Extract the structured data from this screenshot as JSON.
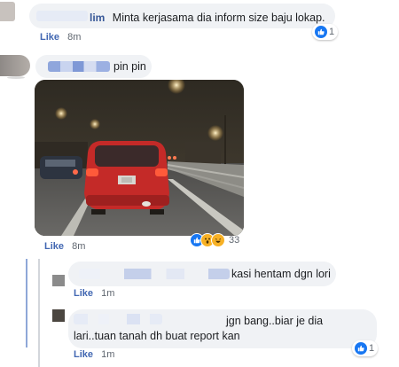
{
  "comments": [
    {
      "id": "c1",
      "author_visible": "lim",
      "text": "Minta kerjasama dia inform size baju lokap.",
      "like_label": "Like",
      "time": "8m",
      "reaction_count": "1"
    },
    {
      "id": "c2",
      "text": "pin pin",
      "like_label": "Like",
      "time": "8m",
      "reaction_count": "33",
      "photo_plate": "WXY 8"
    }
  ],
  "replies": [
    {
      "id": "r1",
      "text": "kasi hentam dgn lori",
      "like_label": "Like",
      "time": "1m"
    },
    {
      "id": "r2",
      "text_line1": "jgn bang..biar je dia",
      "text_line2": "lari..tuan tanah dh buat report kan",
      "like_label": "Like",
      "time": "1m",
      "reaction_count": "1"
    }
  ],
  "colors": {
    "link": "#4267b2",
    "bubble": "#f0f2f5",
    "blur_blue": "#a9bde8",
    "blur_light": "#dbe2f3"
  },
  "icons": [
    "like-reaction-icon",
    "wow-reaction-icon",
    "haha-reaction-icon"
  ]
}
